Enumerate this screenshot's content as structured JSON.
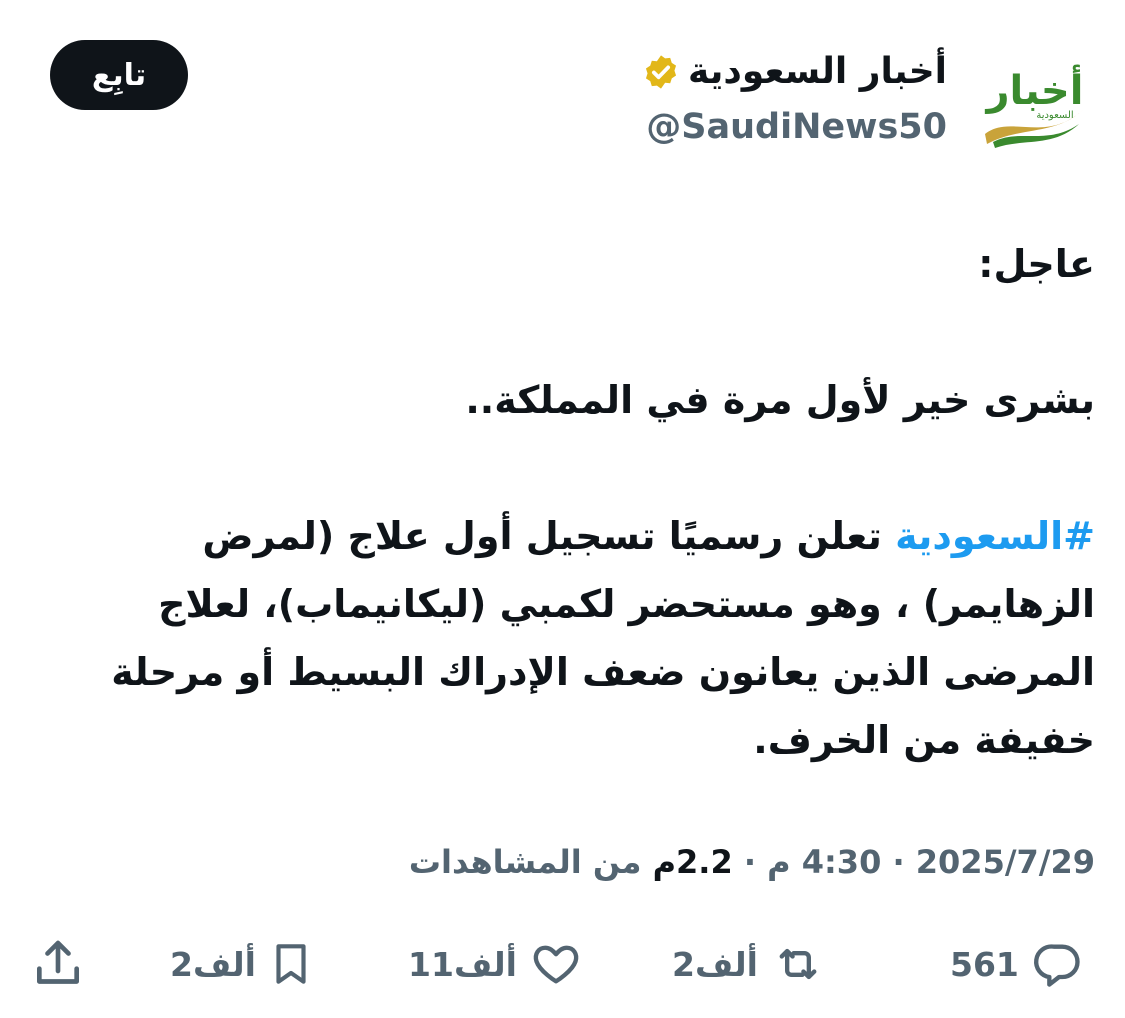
{
  "account": {
    "display_name": "أخبار السعودية",
    "handle": "@SaudiNews50",
    "avatar_text": "أخبار",
    "avatar_subtext": "السعودية",
    "verified": true,
    "follow_label": "تابِع"
  },
  "tweet": {
    "line1": "عاجل:",
    "line2": "بشرى خير لأول مرة في المملكة..",
    "hashtag": "#السعودية",
    "paragraph_after_hashtag": " تعلن رسميًا تسجيل أول علاج (لمرض الزهايمر) ، وهو مستحضر لكمبي (ليكانيماب)، لعلاج المرضى الذين يعانون ضعف الإدراك البسيط أو مرحلة خفيفة من الخرف."
  },
  "meta": {
    "date": "2025/7/29",
    "separator": "·",
    "time": "4:30 م",
    "views_count": "2.2م",
    "views_label": "من المشاهدات"
  },
  "actions": {
    "replies": "561",
    "reposts": "2ألف",
    "likes": "11ألف",
    "bookmarks": "2ألف"
  },
  "colors": {
    "text_primary": "#0f1419",
    "text_secondary": "#536471",
    "hashtag": "#1d9bf0",
    "verified_badge": "#e2b719",
    "follow_button": "#0f1419",
    "avatar_green": "#3a8a2e",
    "avatar_gold": "#c9a33a"
  }
}
